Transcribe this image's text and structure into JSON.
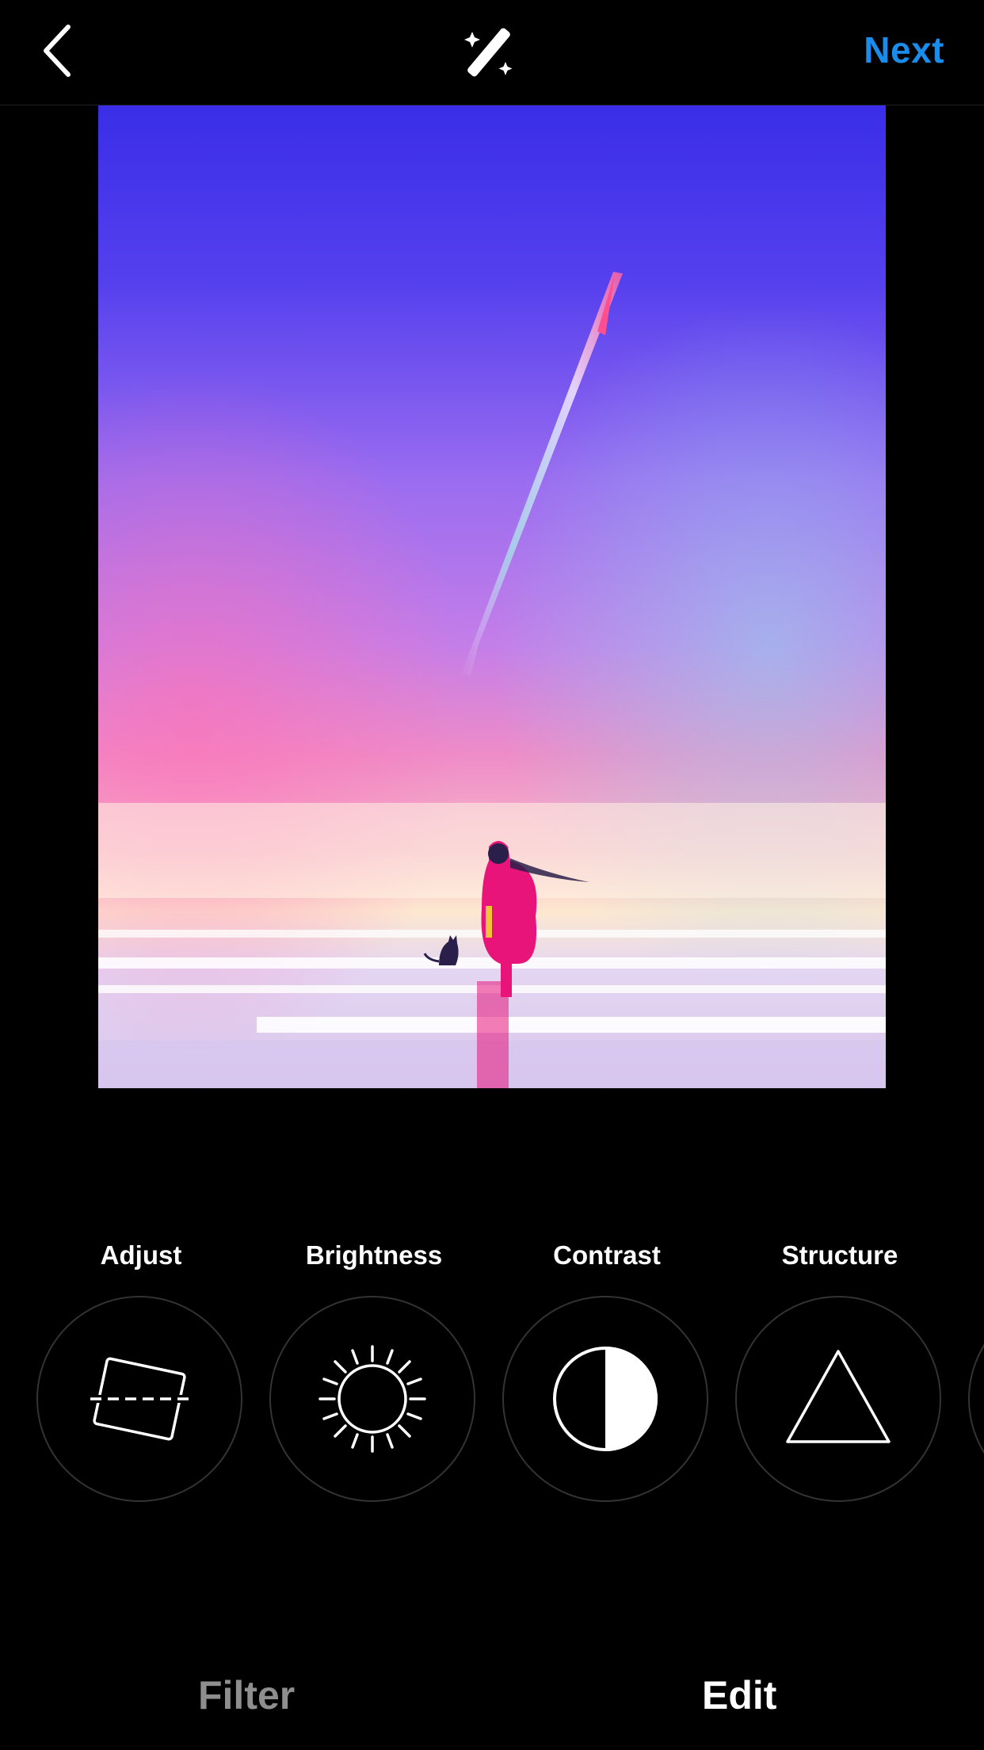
{
  "header": {
    "back_icon": "chevron-left-icon",
    "magic_icon": "magic-wand-icon",
    "next_label": "Next",
    "next_color": "#1a8cec"
  },
  "photo": {
    "subject": "painted sky with person in red coat and cat walking on reflective ground"
  },
  "tools": [
    {
      "label": "Adjust",
      "icon": "adjust-icon"
    },
    {
      "label": "Brightness",
      "icon": "brightness-icon"
    },
    {
      "label": "Contrast",
      "icon": "contrast-icon"
    },
    {
      "label": "Structure",
      "icon": "structure-icon"
    }
  ],
  "tabs": {
    "filter_label": "Filter",
    "edit_label": "Edit",
    "active": "Edit"
  }
}
